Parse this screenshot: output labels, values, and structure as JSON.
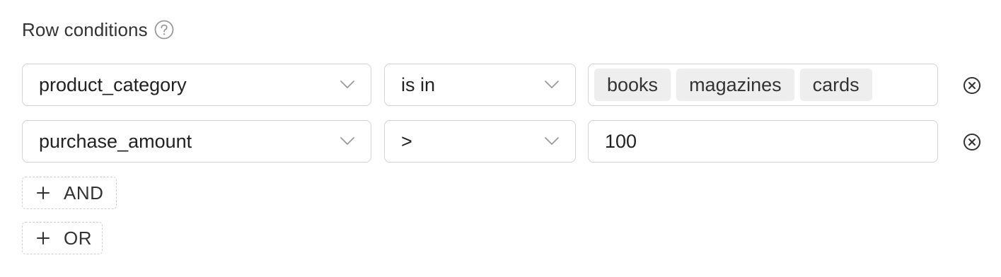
{
  "header": {
    "title": "Row conditions",
    "help_icon": "question-circle-icon"
  },
  "conditions": [
    {
      "field": "product_category",
      "operator": "is in",
      "values": [
        "books",
        "magazines",
        "cards"
      ]
    },
    {
      "field": "purchase_amount",
      "operator": ">",
      "value": "100"
    }
  ],
  "actions": {
    "add_and_label": "AND",
    "add_or_label": "OR"
  },
  "icons": {
    "chevron": "chevron-down-icon",
    "remove": "remove-circle-x-icon",
    "add": "plus-icon"
  },
  "colors": {
    "border": "#d3d3d3",
    "tag_background": "#eeeeee",
    "icon": "#999999",
    "text": "#222222"
  }
}
